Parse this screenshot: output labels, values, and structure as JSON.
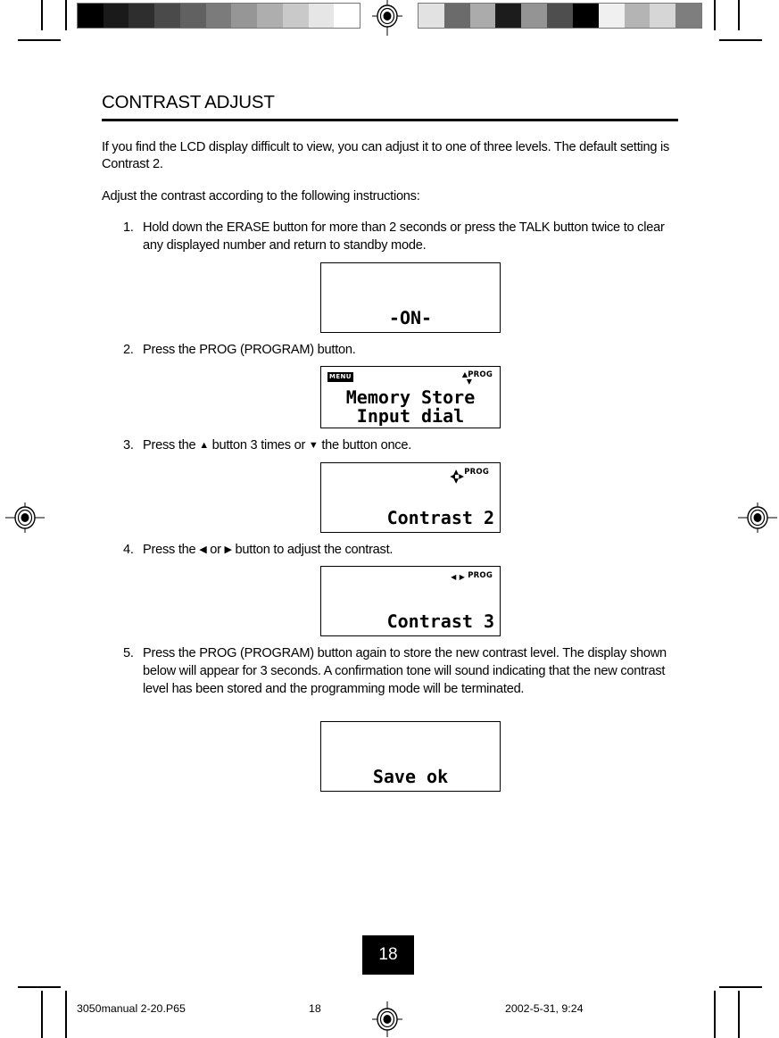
{
  "document": {
    "title": "CONTRAST ADJUST",
    "intro": [
      "If you find the LCD display difficult to view, you can adjust it to one of three levels. The default setting is Contrast 2.",
      "Adjust the contrast according to the following instructions:"
    ],
    "steps": [
      {
        "number": "1.",
        "text_before": "Hold down the ERASE button for more than 2 seconds or press the TALK button twice to clear any displayed number and return to standby mode.",
        "text_after": ""
      },
      {
        "number": "2.",
        "text_before": "Press the PROG (PROGRAM) button.",
        "text_after": ""
      },
      {
        "number": "3.",
        "text_before": "Press the ",
        "arrow_up": "▲",
        "text_middle": " button 3 times or ",
        "arrow_down": "▼",
        "text_after": " the button once."
      },
      {
        "number": "4.",
        "text_before": "Press the ",
        "arrow_left": "◀",
        "text_middle": " or ",
        "arrow_right": "▶",
        "text_after": " button to adjust the contrast."
      },
      {
        "number": "5.",
        "text_before": "Press the PROG (PROGRAM) button again to store the new contrast level. The display shown below will appear for 3 seconds. A confirmation tone will sound indicating that the new contrast level has been stored and the programming mode will be terminated.",
        "text_after": ""
      }
    ],
    "lcd_screens": [
      {
        "id": "standby",
        "center_text": "-ON-"
      },
      {
        "id": "memory-store",
        "menu_badge": "MENU",
        "prog_label": "PROG",
        "arrow_up": "▲",
        "arrow_down": "▼",
        "line1": "Memory Store",
        "line2": "Input dial"
      },
      {
        "id": "contrast-2",
        "prog_label": "PROG",
        "arrow_up": "▲",
        "arrow_down": "▼",
        "arrow_left": "◀",
        "arrow_right": "▶",
        "bottom_text": "Contrast 2"
      },
      {
        "id": "contrast-3",
        "prog_label": "PROG",
        "arrow_left": "◀",
        "arrow_right": "▶",
        "bottom_text": "Contrast 3"
      },
      {
        "id": "save-ok",
        "bottom_text": "Save ok"
      }
    ],
    "page_number": "18",
    "footer": {
      "file_name": "3050manual 2-20.P65",
      "page": "18",
      "timestamp": "2002-5-31, 9:24"
    }
  },
  "calibration": {
    "left_patches": [
      "#000000",
      "#1a1a1a",
      "#2e2e2e",
      "#4a4a4a",
      "#616161",
      "#7b7b7b",
      "#969696",
      "#aeaeae",
      "#c9c9c9",
      "#e6e6e6",
      "#ffffff"
    ],
    "right_patches": [
      "#e2e2e2",
      "#6b6b6b",
      "#ababab",
      "#1c1c1c",
      "#949494",
      "#4e4e4e",
      "#000000",
      "#f0f0f0",
      "#b4b4b4",
      "#d6d6d6",
      "#7e7e7e"
    ]
  }
}
